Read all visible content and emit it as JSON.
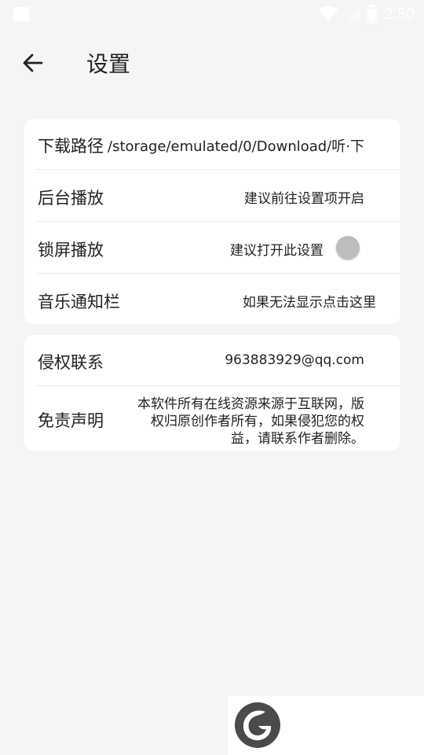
{
  "status": {
    "time": "2:50"
  },
  "header": {
    "title": "设置"
  },
  "settings": {
    "rows": [
      {
        "label": "下载路径",
        "value": "/storage/emulated/0/Download/听·下"
      },
      {
        "label": "后台播放",
        "value": "建议前往设置项开启"
      },
      {
        "label": "锁屏播放",
        "value": "建议打开此设置",
        "toggle_on": false
      },
      {
        "label": "音乐通知栏",
        "value": "如果无法显示点击这里"
      }
    ]
  },
  "about": {
    "contact": {
      "label": "侵权联系",
      "value": "963883929@qq.com"
    },
    "disclaimer": {
      "label": "免责声明",
      "lines": [
        "本软件所有在线资源来源于互联网，版",
        "权归原创作者所有，如果侵犯您的权",
        "益，请联系作者删除。"
      ]
    }
  },
  "colors": {
    "background": "#f5f5f5",
    "card": "#ffffff",
    "toggle_off": "#bdbdbd"
  }
}
